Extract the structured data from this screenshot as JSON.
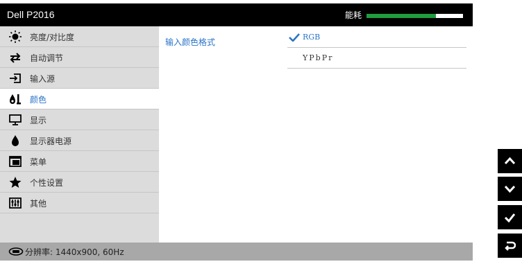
{
  "header": {
    "title": "Dell P2016",
    "energy_label": "能耗",
    "energy_level": 0.72
  },
  "sidebar": {
    "items": [
      {
        "label": "亮度/对比度",
        "icon": "brightness-icon"
      },
      {
        "label": "自动调节",
        "icon": "auto-adjust-icon"
      },
      {
        "label": "输入源",
        "icon": "input-source-icon"
      },
      {
        "label": "颜色",
        "icon": "color-icon",
        "active": true
      },
      {
        "label": "显示",
        "icon": "display-icon"
      },
      {
        "label": "显示器电源",
        "icon": "power-icon"
      },
      {
        "label": "菜单",
        "icon": "menu-icon"
      },
      {
        "label": "个性设置",
        "icon": "star-icon"
      },
      {
        "label": "其他",
        "icon": "other-icon"
      }
    ]
  },
  "content": {
    "label": "输入颜色格式",
    "options": [
      {
        "label": "RGB",
        "selected": true
      },
      {
        "label": "YPbPr",
        "selected": false
      }
    ]
  },
  "status": {
    "text": "分辨率: 1440x900, 60Hz"
  },
  "nav_buttons": [
    {
      "name": "up",
      "icon": "chevron-up-icon"
    },
    {
      "name": "down",
      "icon": "chevron-down-icon"
    },
    {
      "name": "ok",
      "icon": "check-icon"
    },
    {
      "name": "back",
      "icon": "back-icon"
    }
  ],
  "colors": {
    "accent": "#2b74c8",
    "energy": "#1f9d40",
    "titlebar": "#000000",
    "sidebar": "#dcdcdc",
    "statusbar": "#a8a8a8"
  }
}
